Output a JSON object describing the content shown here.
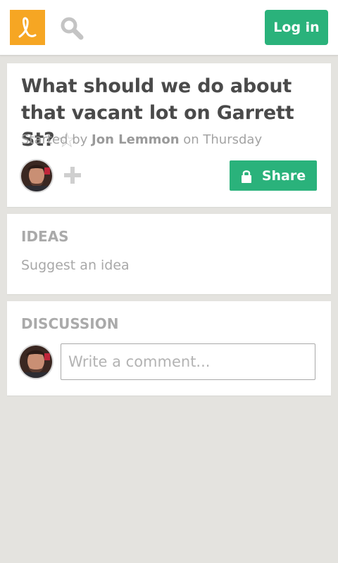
{
  "colors": {
    "accent_green": "#2ab27b",
    "logo_orange": "#f6a623",
    "page_background": "#e4e3df",
    "card_background": "#ffffff"
  },
  "header": {
    "logo_icon": "loomio-logo-icon",
    "search_icon": "search-icon",
    "login_label": "Log in"
  },
  "discussion": {
    "title": "What should we do about that vacant lot on Garrett St?",
    "star_icon": "star-outline-icon",
    "byline_prefix": "Started by",
    "author": "Jon Lemmon",
    "byline_suffix": "on Thursday",
    "add_participant_icon": "plus-icon",
    "share_icon": "lock-icon",
    "share_label": "Share"
  },
  "ideas": {
    "heading": "IDEAS",
    "suggest_label": "Suggest an idea"
  },
  "comments": {
    "heading": "DISCUSSION",
    "input_placeholder": "Write a comment..."
  }
}
